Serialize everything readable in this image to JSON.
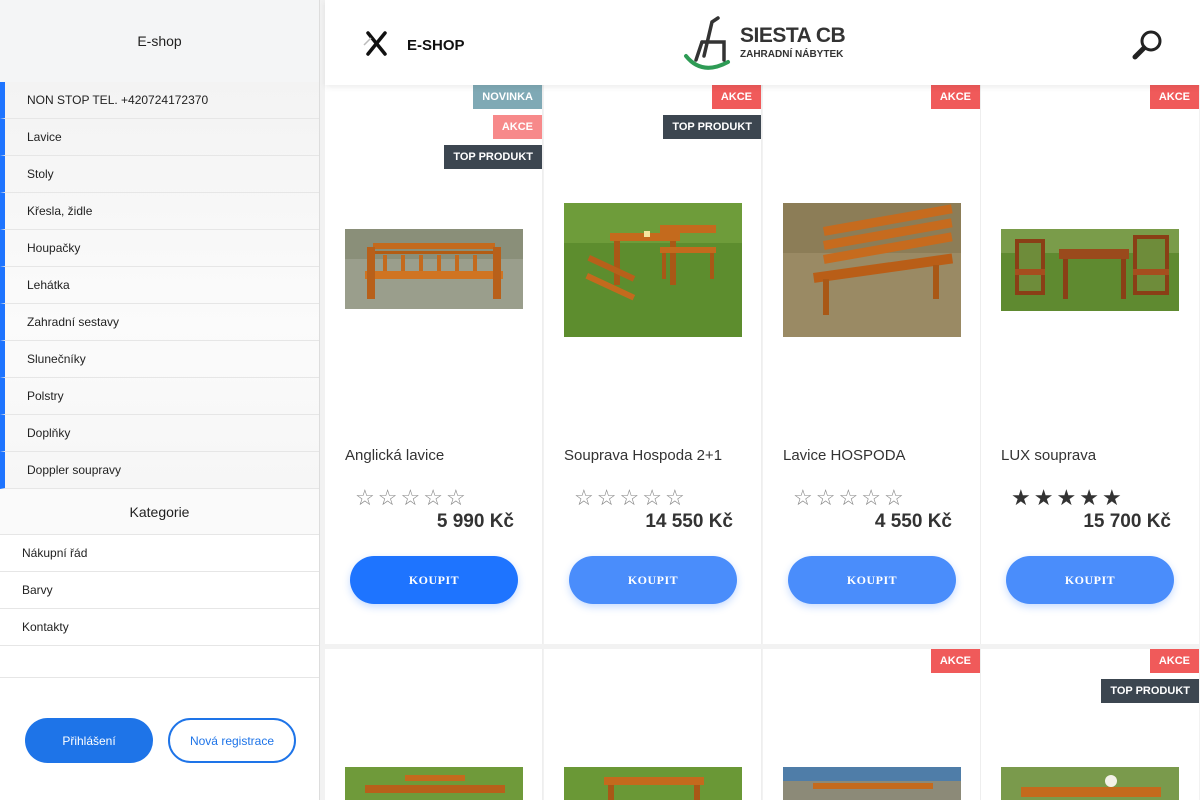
{
  "sidebar": {
    "header": "E-shop",
    "menu": [
      "NON STOP TEL. +420724172370",
      "Lavice",
      "Stoly",
      "Křesla, židle",
      "Houpačky",
      "Lehátka",
      "Zahradní sestavy",
      "Slunečníky",
      "Polstry",
      "Doplňky",
      "Doppler soupravy"
    ],
    "category_title": "Kategorie",
    "pages": [
      "Nákupní řád",
      "Barvy",
      "Kontakty"
    ],
    "login_label": "Přihlášení",
    "register_label": "Nová registrace"
  },
  "header": {
    "title": "E-SHOP",
    "logo_title": "SIESTA CB",
    "logo_subtitle": "ZAHRADNÍ NÁBYTEK"
  },
  "products": [
    {
      "name": "Anglická lavice",
      "price": "5 990 Kč",
      "rating": 0,
      "badges": [
        "NOVINKA",
        "AKCE",
        "TOP PRODUKT"
      ],
      "buy_label": "KOUPIT"
    },
    {
      "name": "Souprava Hospoda 2+1",
      "price": "14 550 Kč",
      "rating": 0,
      "badges": [
        "AKCE",
        "TOP PRODUKT"
      ],
      "buy_label": "KOUPIT"
    },
    {
      "name": "Lavice HOSPODA",
      "price": "4 550 Kč",
      "rating": 0,
      "badges": [
        "AKCE"
      ],
      "buy_label": "KOUPIT"
    },
    {
      "name": "LUX souprava",
      "price": "15 700 Kč",
      "rating": 5,
      "badges": [
        "AKCE"
      ],
      "buy_label": "KOUPIT"
    }
  ],
  "second_row_badges": [
    [],
    [],
    [
      "AKCE"
    ],
    [
      "AKCE",
      "TOP PRODUKT"
    ]
  ],
  "colors": {
    "accent": "#1e74ff",
    "badge_new": "#7fa9b5",
    "badge_akce": "#f05a5a",
    "badge_top": "#3c4650"
  }
}
